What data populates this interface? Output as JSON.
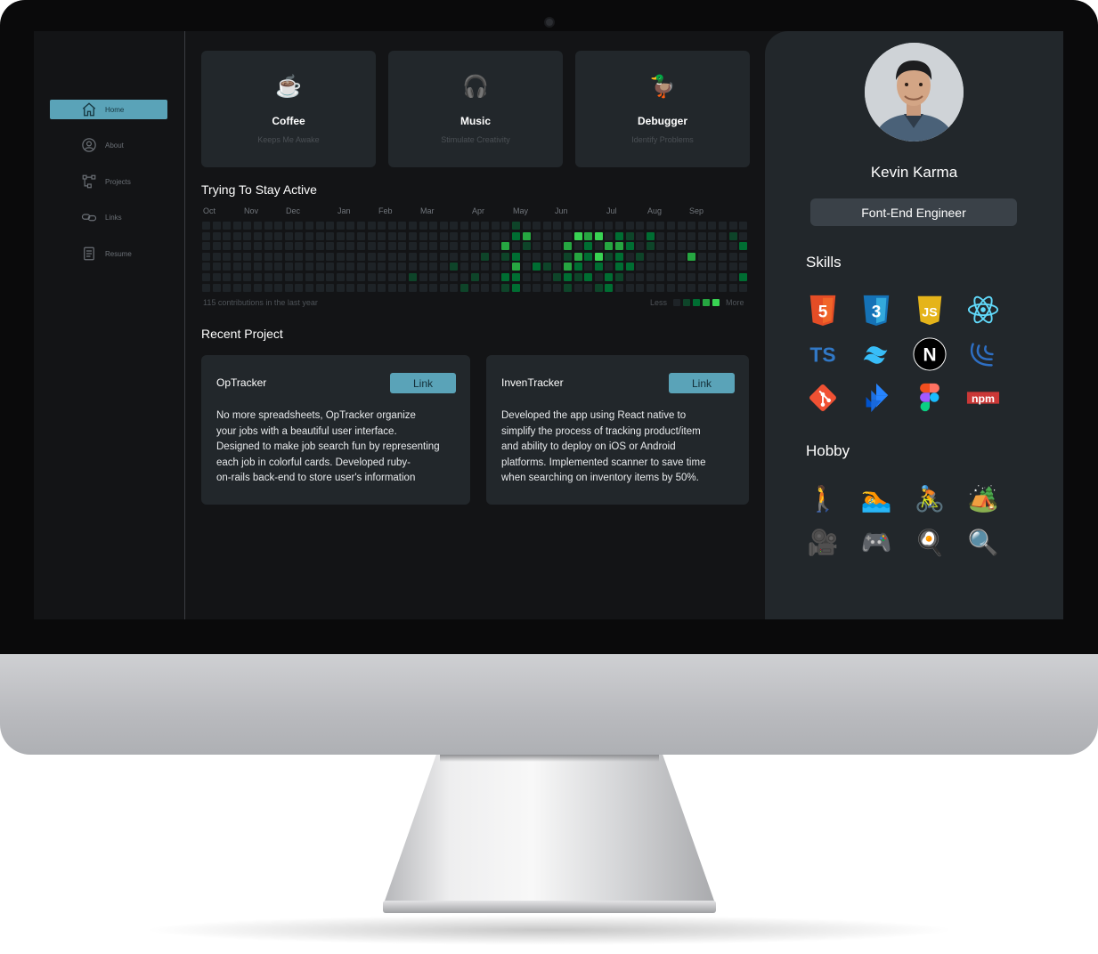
{
  "sidebar": {
    "items": [
      {
        "label": "Home",
        "icon": "home-icon",
        "active": true
      },
      {
        "label": "About",
        "icon": "user-circle-icon",
        "active": false
      },
      {
        "label": "Projects",
        "icon": "project-tree-icon",
        "active": false
      },
      {
        "label": "Links",
        "icon": "link-icon",
        "active": false
      },
      {
        "label": "Resume",
        "icon": "document-icon",
        "active": false
      }
    ]
  },
  "cards": [
    {
      "emoji": "☕",
      "title": "Coffee",
      "subtitle": "Keeps Me Awake"
    },
    {
      "emoji": "🎧",
      "title": "Music",
      "subtitle": "Stimulate Creativity"
    },
    {
      "emoji": "🦆",
      "title": "Debugger",
      "subtitle": "Identify Problems"
    }
  ],
  "activity": {
    "title": "Trying To Stay Active",
    "months": [
      "Oct",
      "Nov",
      "Dec",
      "Jan",
      "Feb",
      "Mar",
      "Apr",
      "May",
      "Jun",
      "Jul",
      "Aug",
      "Sep"
    ],
    "summary": "115 contributions in the last year",
    "legend_less": "Less",
    "legend_more": "More",
    "levels": [
      "#1e2327",
      "#0e4429",
      "#006d32",
      "#26a641",
      "#39d353"
    ]
  },
  "recent": {
    "title": "Recent Project",
    "projects": [
      {
        "name": "OpTracker",
        "link_label": "Link",
        "lines": [
          "No more spreadsheets, OpTracker organize",
          "your jobs with a beautiful user interface.",
          "Designed to make job search fun by representing",
          "each job in colorful cards. Developed ruby-",
          "on-rails back-end to store user's information"
        ]
      },
      {
        "name": "InvenTracker",
        "link_label": "Link",
        "lines": [
          "Developed the app using React native to",
          "simplify the process of tracking product/item",
          "and ability to deploy on iOS or Android",
          "platforms. Implemented scanner to save time",
          "when searching on inventory items by 50%."
        ]
      }
    ]
  },
  "profile": {
    "name": "Kevin Karma",
    "role": "Font-End Engineer",
    "skills_title": "Skills",
    "hobby_title": "Hobby",
    "skills": [
      "html5-icon",
      "css3-icon",
      "javascript-icon",
      "react-icon",
      "typescript-icon",
      "tailwind-icon",
      "nextjs-icon",
      "jquery-icon",
      "git-icon",
      "jira-icon",
      "figma-icon",
      "npm-icon"
    ],
    "skill_text": {
      "typescript": "TS",
      "npm": "npm",
      "nextjs": "N",
      "html5": "5",
      "css3": "3",
      "javascript": "JS"
    },
    "hobbies": [
      {
        "emoji": "🚶",
        "name": "hiking-icon"
      },
      {
        "emoji": "🏊",
        "name": "swimming-icon"
      },
      {
        "emoji": "🚴",
        "name": "cycling-icon"
      },
      {
        "emoji": "🏕️",
        "name": "camping-icon"
      },
      {
        "emoji": "🎥",
        "name": "video-camera-icon"
      },
      {
        "emoji": "🎮",
        "name": "game-controller-icon"
      },
      {
        "emoji": "🍳",
        "name": "cooking-icon"
      },
      {
        "emoji": "🔍",
        "name": "magnifier-icon"
      }
    ]
  }
}
